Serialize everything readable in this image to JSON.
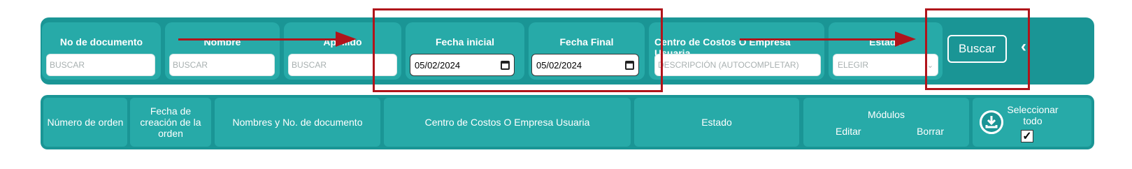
{
  "filters": {
    "documento": {
      "label": "No de documento",
      "placeholder": "BUSCAR"
    },
    "nombre": {
      "label": "Nombre",
      "placeholder": "BUSCAR"
    },
    "apellido": {
      "label": "Apellido",
      "placeholder": "BUSCAR"
    },
    "fecha_inicial": {
      "label": "Fecha inicial",
      "value": "05/02/2024"
    },
    "fecha_final": {
      "label": "Fecha Final",
      "value": "05/02/2024"
    },
    "centro": {
      "label": "Centro de Costos O Empresa Usuaria",
      "placeholder": "DESCRIPCIÓN (AUTOCOMPLETAR)"
    },
    "estado": {
      "label": "Estado",
      "selected": "ELEGIR"
    },
    "buscar_label": "Buscar"
  },
  "table": {
    "columns": {
      "numero_orden": "Número de orden",
      "fecha_creacion": "Fecha de creación de la orden",
      "nombres": "Nombres y No. de documento",
      "centro": "Centro de Costos O Empresa Usuaria",
      "estado": "Estado",
      "modulos": "Módulos",
      "editar": "Editar",
      "borrar": "Borrar",
      "seleccionar": "Seleccionar todo"
    },
    "select_all_checked": true
  },
  "colors": {
    "bar": "#1a9595",
    "cell": "#27aaa8",
    "annotation": "#b0141b"
  }
}
